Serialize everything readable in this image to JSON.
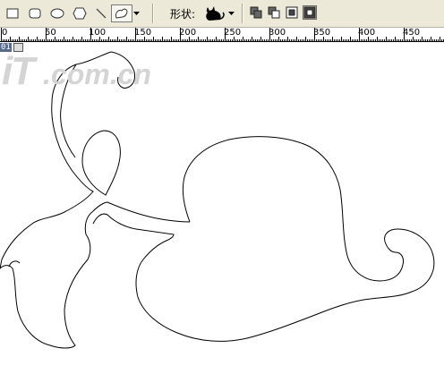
{
  "options_bar": {
    "tools": [
      {
        "name": "rectangle-tool"
      },
      {
        "name": "rounded-rectangle-tool"
      },
      {
        "name": "ellipse-tool"
      },
      {
        "name": "polygon-tool"
      },
      {
        "name": "line-tool"
      },
      {
        "name": "custom-shape-tool",
        "selected": true
      }
    ],
    "shape_label": "形状:",
    "modes": [
      {
        "name": "add-to-shape-area"
      },
      {
        "name": "subtract-from-shape-area"
      },
      {
        "name": "intersect-shape-areas"
      },
      {
        "name": "exclude-overlapping-shape-areas",
        "selected": true
      }
    ]
  },
  "ruler": {
    "labels": [
      "0",
      "50",
      "100",
      "150",
      "200",
      "250",
      "300",
      "350",
      "400",
      "450"
    ]
  },
  "document": {
    "tab_number": "01"
  },
  "watermark": {
    "text": "iT.com.cn"
  }
}
